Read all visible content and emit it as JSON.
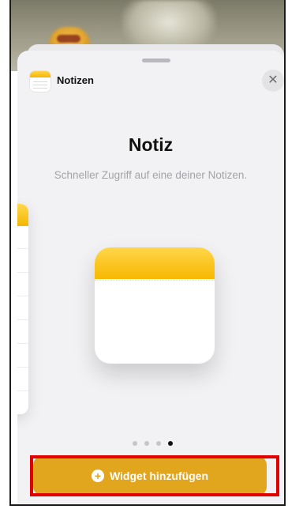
{
  "sheet": {
    "app_name": "Notizen",
    "close_icon": "xmark-icon"
  },
  "widget": {
    "title": "Notiz",
    "description": "Schneller Zugriff auf eine deiner Notizen.",
    "page_count": 4,
    "active_page": 4
  },
  "actions": {
    "add_widget_label": "Widget hinzufügen",
    "add_icon": "plus-circle-icon"
  },
  "colors": {
    "accent": "#e1a61d",
    "notes_yellow": "#f7b800",
    "highlight": "#e10000"
  }
}
